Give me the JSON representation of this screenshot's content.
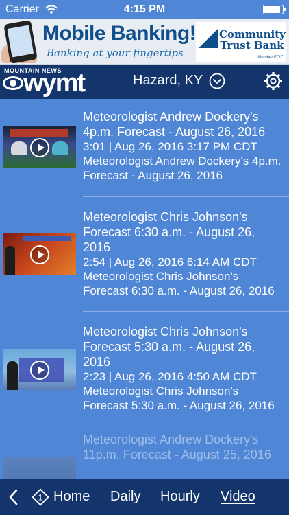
{
  "status_bar": {
    "carrier": "Carrier",
    "time": "4:15 PM",
    "wifi_icon": "wifi-icon",
    "battery_level": 0.85
  },
  "ad": {
    "headline": "Mobile Banking!",
    "tagline": "Banking at your fingertips",
    "bank_name_line1": "Community",
    "bank_name_line2": "Trust Bank",
    "bank_footer": "Member FDIC"
  },
  "header": {
    "logo_top": "MOUNTAIN NEWS",
    "logo_text": "wymt",
    "location": "Hazard, KY",
    "settings_icon": "gear-icon",
    "location_icon": "chevron-down-circle-icon"
  },
  "videos": [
    {
      "title": "Meteorologist Andrew Dockery's 4p.m. Forecast - August 26, 2016",
      "meta": "3:01 | Aug 26, 2016 3:17 PM CDT",
      "description": "Meteorologist Andrew Dockery's 4p.m. Forecast - August 26, 2016"
    },
    {
      "title": "Meteorologist Chris Johnson's Forecast 6:30 a.m. - August 26, 2016",
      "meta": "2:54 | Aug 26, 2016 6:14 AM CDT",
      "description": "Meteorologist Chris Johnson's Forecast 6:30 a.m. - August 26, 2016"
    },
    {
      "title": "Meteorologist Chris Johnson's Forecast 5:30 a.m. - August 26, 2016",
      "meta": "2:23 | Aug 26, 2016 4:50 AM CDT",
      "description": "Meteorologist Chris Johnson's Forecast 5:30 a.m. - August 26, 2016"
    },
    {
      "title": "Meteorologist Andrew Dockery's 11p.m. Forecast - August 25, 2016"
    }
  ],
  "nav": {
    "back_icon": "chevron-left-icon",
    "home_icon": "home-diamond-icon",
    "home_icon_text": "1",
    "home": "Home",
    "daily": "Daily",
    "hourly": "Hourly",
    "video": "Video",
    "active": "video"
  }
}
